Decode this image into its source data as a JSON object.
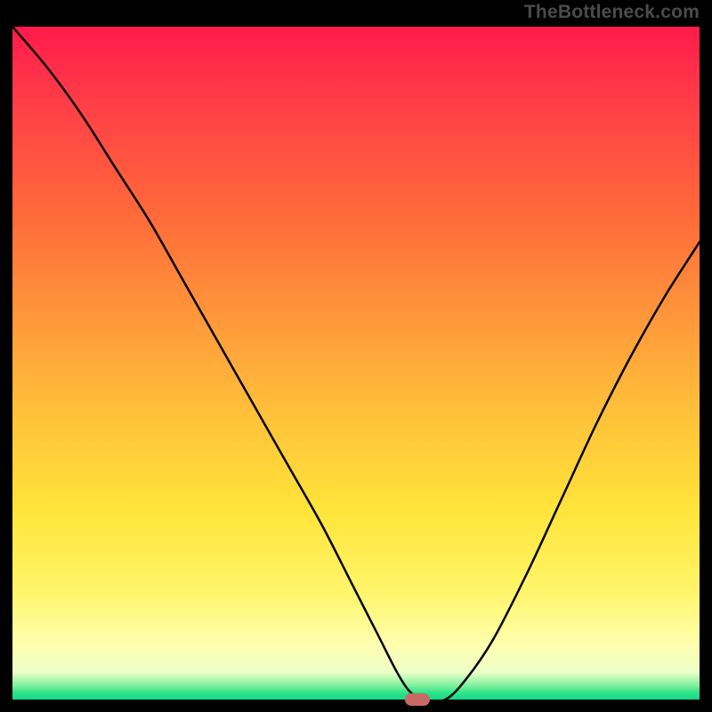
{
  "watermark": "TheBottleneck.com",
  "chart_data": {
    "type": "line",
    "title": "",
    "xlabel": "",
    "ylabel": "",
    "xlim": [
      0,
      100
    ],
    "ylim": [
      0,
      100
    ],
    "grid": false,
    "legend": false,
    "background_gradient": {
      "direction": "vertical",
      "stops": [
        {
          "pos": 0,
          "color": "#ff1a4a"
        },
        {
          "pos": 28,
          "color": "#ff6a3a"
        },
        {
          "pos": 58,
          "color": "#ffc23a"
        },
        {
          "pos": 84,
          "color": "#fff56a"
        },
        {
          "pos": 96,
          "color": "#eaffc8"
        },
        {
          "pos": 100,
          "color": "#17d88a"
        }
      ]
    },
    "series": [
      {
        "name": "bottleneck-curve",
        "color": "#000000",
        "stroke_width": 2.5,
        "x": [
          0,
          5,
          10,
          15,
          20,
          25,
          30,
          35,
          40,
          45,
          50,
          53,
          56,
          58,
          60,
          63,
          66,
          70,
          75,
          80,
          85,
          90,
          95,
          100
        ],
        "y": [
          100,
          94,
          87,
          79,
          71,
          62,
          53,
          44,
          35,
          26,
          16,
          10,
          4,
          1,
          0,
          0,
          3,
          9,
          19,
          30,
          41,
          51,
          60,
          68
        ]
      }
    ],
    "marker": {
      "name": "optimal-point",
      "x": 59,
      "y": 0,
      "color": "#c86a64",
      "shape": "rounded-rect"
    }
  }
}
